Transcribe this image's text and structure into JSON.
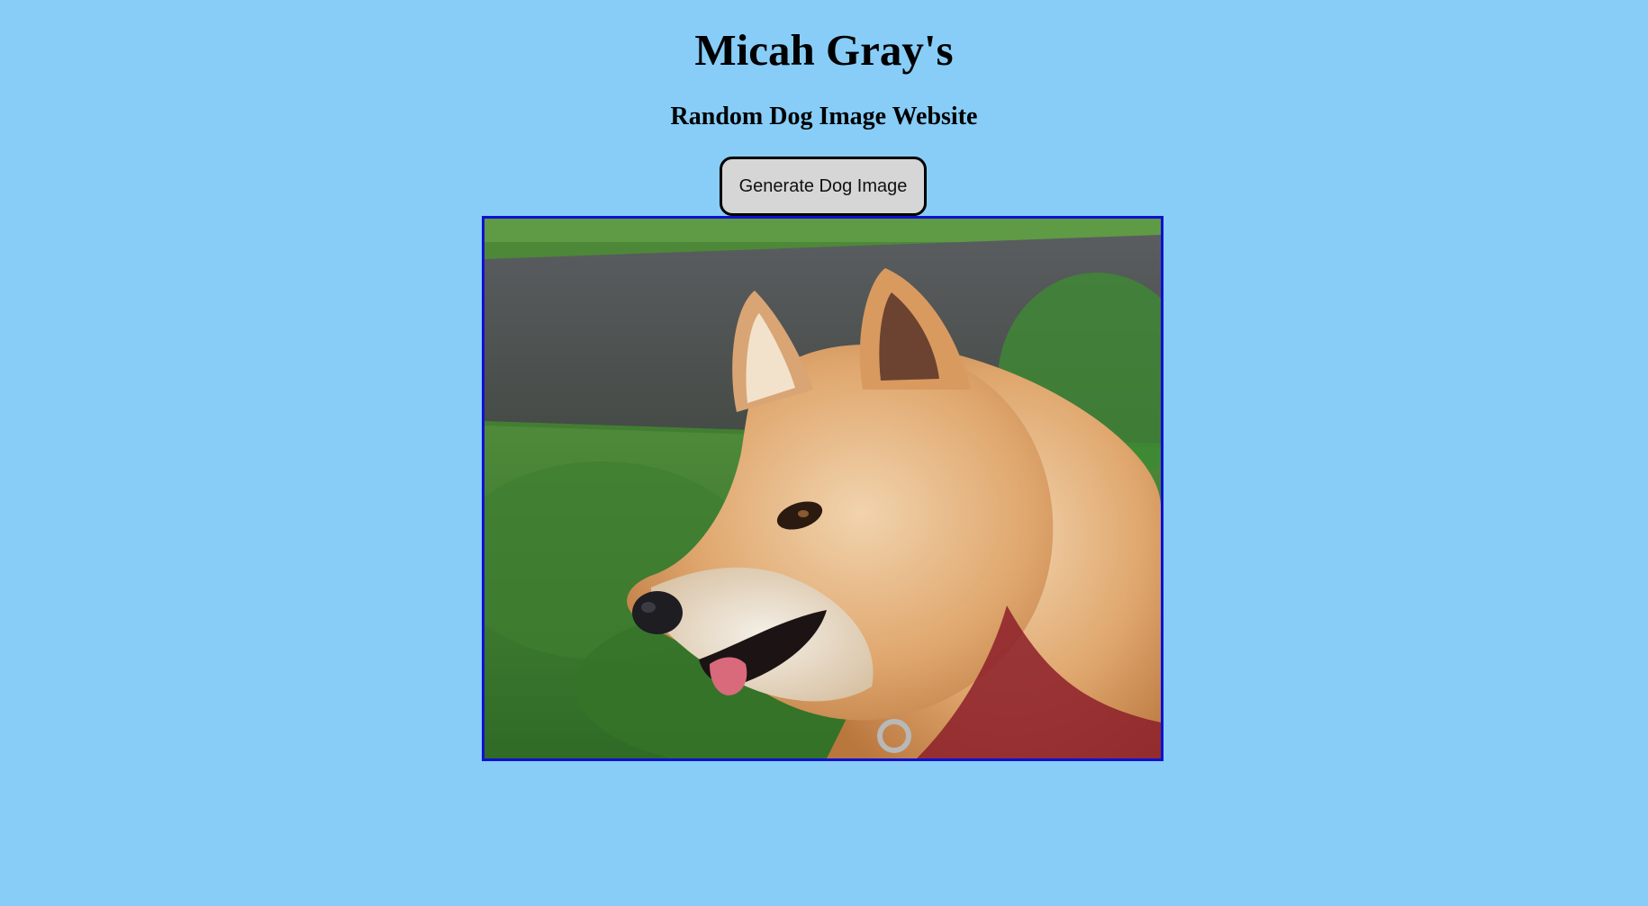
{
  "page": {
    "title": "Micah Gray's",
    "subtitle": "Random Dog Image Website"
  },
  "controls": {
    "generate_label": "Generate Dog Image"
  },
  "dog_image": {
    "subject": "shiba-inu-dog",
    "alt": "Random dog image"
  },
  "colors": {
    "background": "#87cdf8",
    "button_fill": "#d6d6d6",
    "image_border": "#1010d0"
  }
}
